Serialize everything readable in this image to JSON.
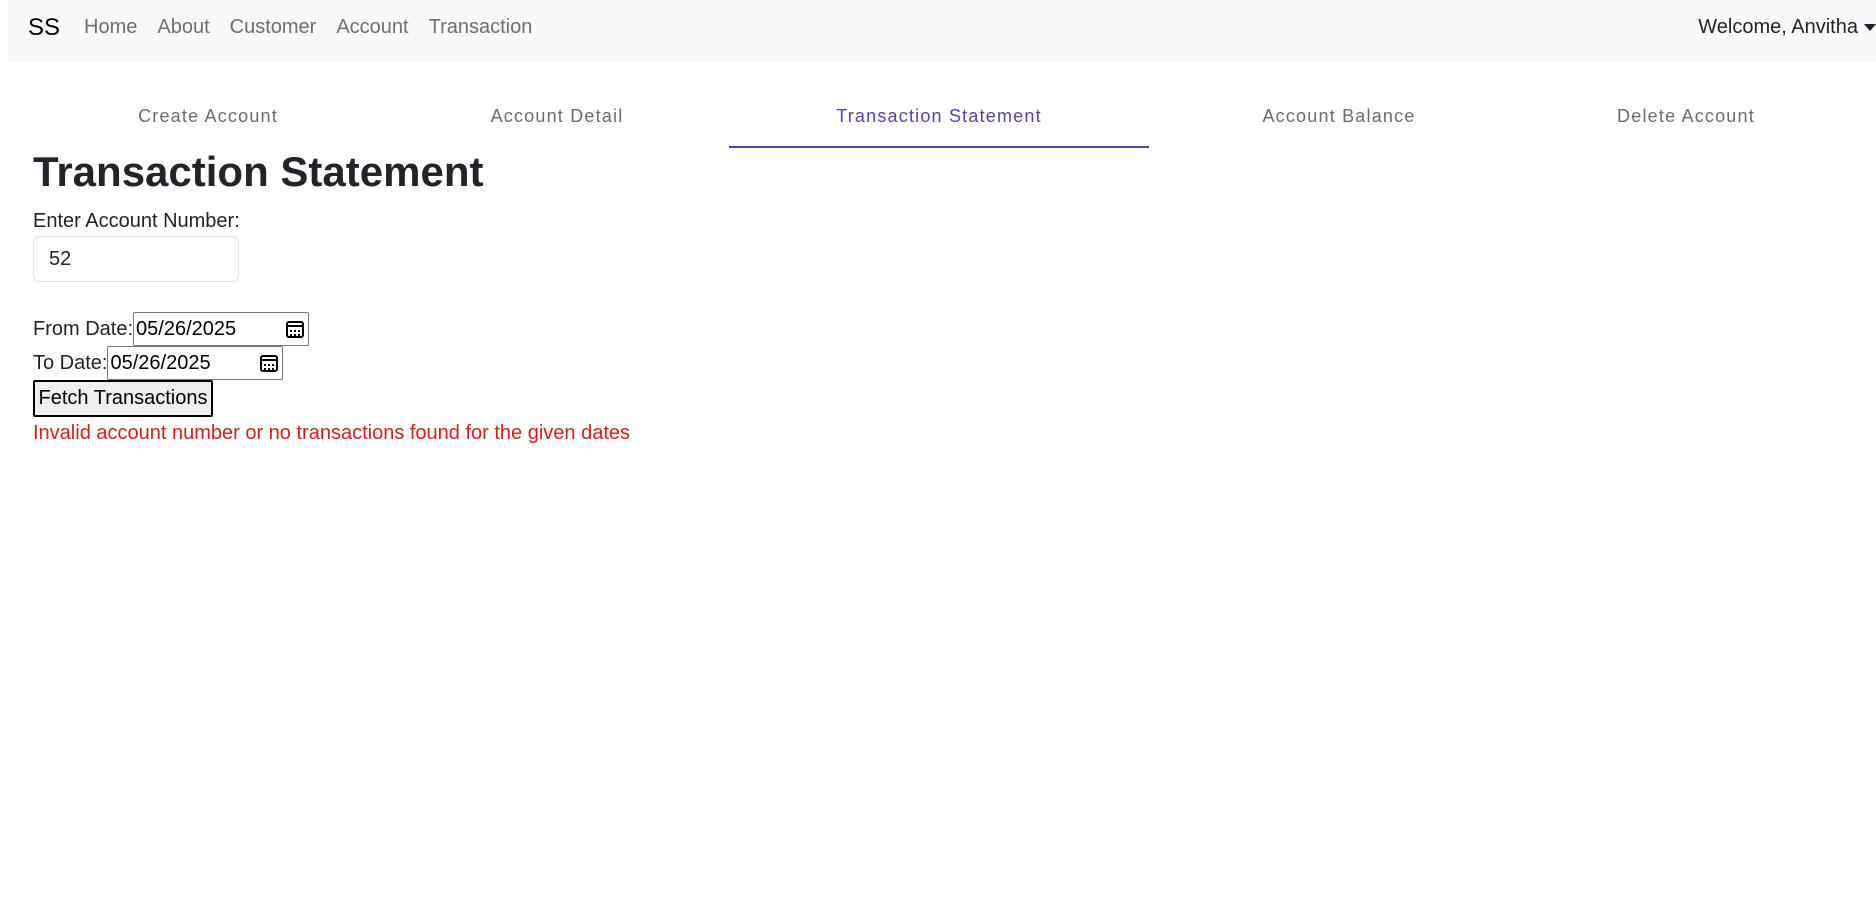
{
  "navbar": {
    "brand": "SS",
    "links": [
      "Home",
      "About",
      "Customer",
      "Account",
      "Transaction"
    ],
    "welcome": "Welcome, Anvitha"
  },
  "tabs": [
    "Create Account",
    "Account Detail",
    "Transaction Statement",
    "Account Balance",
    "Delete Account"
  ],
  "active_tab": "Transaction Statement",
  "page_title": "Transaction Statement",
  "form": {
    "account_label": "Enter Account Number:",
    "account_value": "52",
    "from_label": "From Date:",
    "from_value": "05/26/2025",
    "to_label": "To Date:",
    "to_value": "05/26/2025",
    "fetch_button": "Fetch Transactions"
  },
  "error_message": "Invalid account number or no transactions found for the given dates",
  "colors": {
    "accent": "#5b3fa6",
    "error": "#d21f1f",
    "navbar_bg": "#f8f9fa"
  }
}
